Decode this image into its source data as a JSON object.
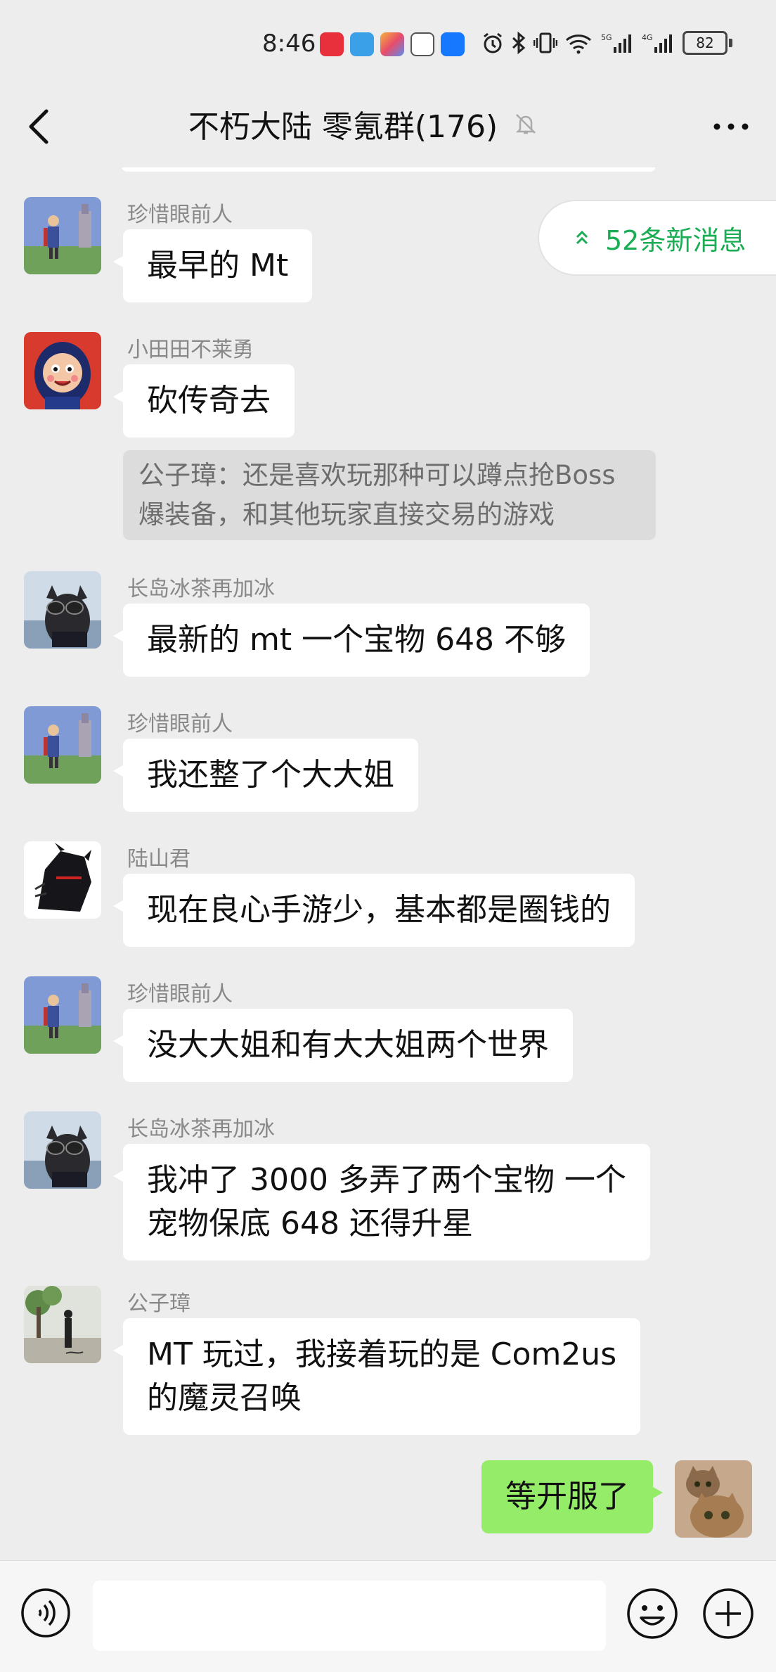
{
  "status_bar": {
    "time": "8:46",
    "battery": "82",
    "app_icons": [
      "xiaohongshu-icon",
      "game-icon",
      "appstore-icon",
      "hand-icon",
      "alipay-icon"
    ],
    "system_icons": [
      "alarm-icon",
      "bluetooth-icon",
      "vibrate-icon",
      "wifi-icon",
      "signal-5g-icon",
      "signal-4g-icon"
    ]
  },
  "header": {
    "title": "不朽大陆 零氪群(176)",
    "mute_icon": "bell-off-icon",
    "more_icon": "more-dots-icon"
  },
  "new_messages": {
    "label": "52条新消息",
    "icon": "double-chevron-up-icon",
    "color": "#1aad54"
  },
  "messages": [
    {
      "sender": "珍惜眼前人",
      "text": "最早的 Mt",
      "avatar": "avatar-landscape-figure"
    },
    {
      "sender": "小田田不莱勇",
      "text": "砍传奇去",
      "avatar": "avatar-cartoon-boy",
      "quote": "公子璋：还是喜欢玩那种可以蹲点抢Boss\n爆装备，和其他玩家直接交易的游戏"
    },
    {
      "sender": "长岛冰茶再加冰",
      "text": "最新的 mt 一个宝物 648 不够",
      "avatar": "avatar-dog-sunglasses"
    },
    {
      "sender": "珍惜眼前人",
      "text": "我还整了个大大姐",
      "avatar": "avatar-landscape-figure"
    },
    {
      "sender": "陆山君",
      "text": "现在良心手游少，基本都是圈钱的",
      "avatar": "avatar-dark-warrior"
    },
    {
      "sender": "珍惜眼前人",
      "text": "没大大姐和有大大姐两个世界",
      "avatar": "avatar-landscape-figure"
    },
    {
      "sender": "长岛冰茶再加冰",
      "text": "我冲了 3000 多弄了两个宝物 一个\n宠物保底 648 还得升星",
      "avatar": "avatar-dog-sunglasses"
    },
    {
      "sender": "公子璋",
      "text": "MT 玩过，我接着玩的是 Com2us\n的魔灵召唤",
      "avatar": "avatar-park-photo"
    }
  ],
  "self_message": {
    "text": "等开服了",
    "avatar": "avatar-cats",
    "bubble_color": "#95ec69"
  },
  "input_bar": {
    "voice_icon": "voice-icon",
    "emoji_icon": "emoji-icon",
    "plus_icon": "plus-icon"
  }
}
